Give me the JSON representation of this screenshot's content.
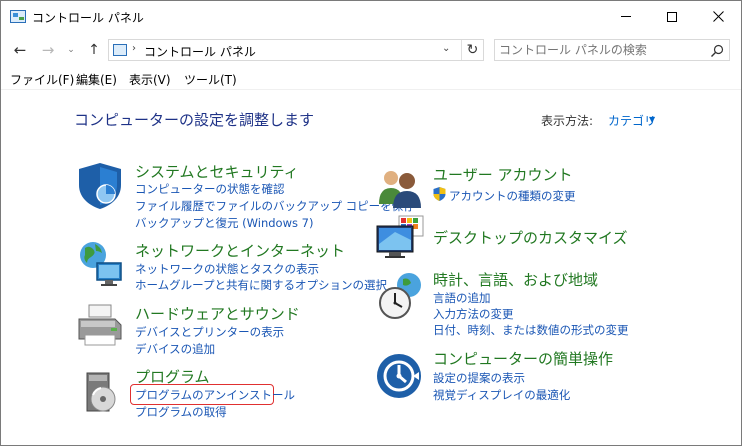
{
  "window": {
    "title": "コントロール パネル",
    "minimize_icon": "minimize-icon",
    "maximize_icon": "maximize-icon",
    "close_icon": "close-icon"
  },
  "address_bar": {
    "path_sep": "›",
    "location": "コントロール パネル",
    "path_sep_end": "›",
    "dropdown_glyph": "⌄",
    "refresh_glyph": "↻"
  },
  "nav": {
    "back_glyph": "←",
    "forward_glyph": "→",
    "recent_glyph": "⌄",
    "up_glyph": "↑"
  },
  "search": {
    "placeholder": "コントロール パネルの検索"
  },
  "menu": {
    "items": [
      "ファイル(F)",
      "編集(E)",
      "表示(V)",
      "ツール(T)"
    ]
  },
  "content": {
    "heading": "コンピューターの設定を調整します",
    "view_by_label": "表示方法:",
    "view_by_value": "カテゴリ",
    "view_by_arrow": "▼"
  },
  "categories": {
    "security": {
      "title": "システムとセキュリティ",
      "links": [
        "コンピューターの状態を確認",
        "ファイル履歴でファイルのバックアップ コピーを保存",
        "バックアップと復元 (Windows 7)"
      ]
    },
    "network": {
      "title": "ネットワークとインターネット",
      "links": [
        "ネットワークの状態とタスクの表示",
        "ホームグループと共有に関するオプションの選択"
      ]
    },
    "hardware": {
      "title": "ハードウェアとサウンド",
      "links": [
        "デバイスとプリンターの表示",
        "デバイスの追加"
      ]
    },
    "programs": {
      "title": "プログラム",
      "links": [
        "プログラムのアンインストール",
        "プログラムの取得"
      ]
    },
    "accounts": {
      "title": "ユーザー アカウント",
      "links": [
        "アカウントの種類の変更"
      ]
    },
    "appearance": {
      "title": "デスクトップのカスタマイズ",
      "links": []
    },
    "clock": {
      "title": "時計、言語、および地域",
      "links": [
        "言語の追加",
        "入力方法の変更",
        "日付、時刻、または数値の形式の変更"
      ]
    },
    "ease": {
      "title": "コンピューターの簡単操作",
      "links": [
        "設定の提案の表示",
        "視覚ディスプレイの最適化"
      ]
    }
  },
  "colors": {
    "category_title": "#217821",
    "link": "#1a56b4",
    "heading": "#1e3287",
    "highlight_box": "#e03030"
  }
}
